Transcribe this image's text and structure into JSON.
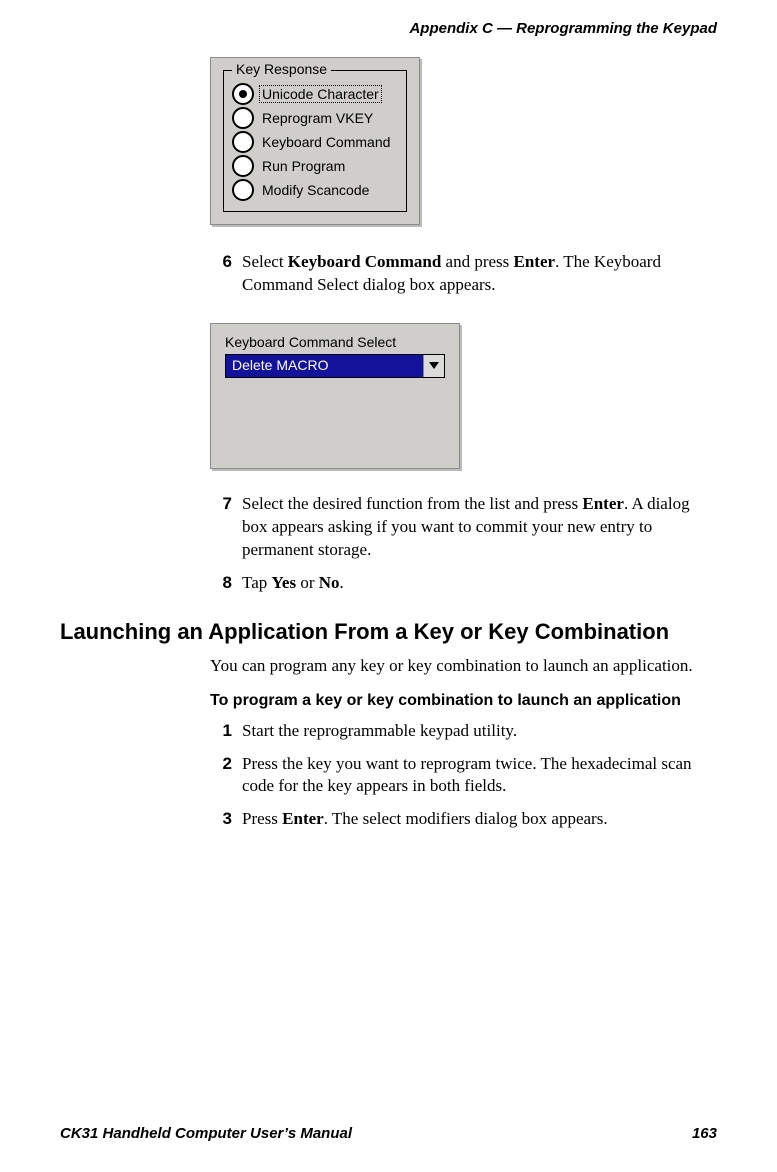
{
  "header": "Appendix C — Reprogramming the Keypad",
  "fig1": {
    "legend": "Key Response",
    "options": [
      {
        "label": "Unicode Character",
        "selected": true,
        "focused": true
      },
      {
        "label": "Reprogram VKEY",
        "selected": false,
        "focused": false
      },
      {
        "label": "Keyboard Command",
        "selected": false,
        "focused": false
      },
      {
        "label": "Run Program",
        "selected": false,
        "focused": false
      },
      {
        "label": "Modify Scancode",
        "selected": false,
        "focused": false
      }
    ]
  },
  "step6_num": "6",
  "step6_a": "Select ",
  "step6_b": "Keyboard Command",
  "step6_c": " and press ",
  "step6_d": "Enter",
  "step6_e": ". The Keyboard Command Select dialog box appears.",
  "fig2": {
    "label": "Keyboard Command Select",
    "value": "Delete MACRO"
  },
  "step7_num": "7",
  "step7_a": "Select the desired function from the list and press ",
  "step7_b": "Enter",
  "step7_c": ". A dialog box appears asking if you want to commit your new entry to permanent storage.",
  "step8_num": "8",
  "step8_a": "Tap ",
  "step8_b": "Yes",
  "step8_c": " or ",
  "step8_d": "No",
  "step8_e": ".",
  "section_heading": "Launching an Application From a Key or Key Combination",
  "section_para": "You can program any key or key combination to launch an application.",
  "subhead": "To program a key or key combination to launch an application",
  "sub_step1_num": "1",
  "sub_step1": "Start the reprogrammable keypad utility.",
  "sub_step2_num": "2",
  "sub_step2": "Press the key you want to reprogram twice. The hexadecimal scan code for the key appears in both fields.",
  "sub_step3_num": "3",
  "sub_step3_a": "Press ",
  "sub_step3_b": "Enter",
  "sub_step3_c": ". The select modifiers dialog box appears.",
  "footer_left": "CK31 Handheld Computer User’s Manual",
  "footer_right": "163"
}
